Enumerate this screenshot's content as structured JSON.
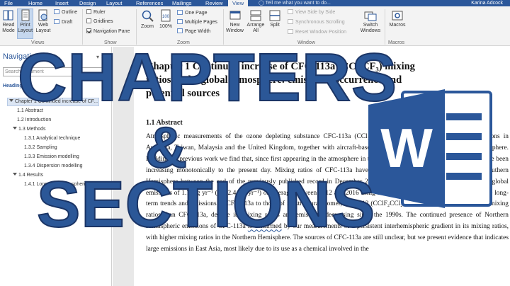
{
  "tabs": [
    "File",
    "Home",
    "Insert",
    "Design",
    "Layout",
    "References",
    "Mailings",
    "Review",
    "View"
  ],
  "active_tab": "View",
  "tell_me": "Tell me what you want to do...",
  "user_name": "Karina Adcock",
  "ribbon": {
    "views": {
      "read_mode_l1": "Read",
      "read_mode_l2": "Mode",
      "print_layout_l1": "Print",
      "print_layout_l2": "Layout",
      "web_layout_l1": "Web",
      "web_layout_l2": "Layout",
      "outline": "Outline",
      "draft": "Draft",
      "group": "Views"
    },
    "show": {
      "ruler": "Ruler",
      "gridlines": "Gridlines",
      "nav_pane": "Navigation Pane",
      "ruler_checked": false,
      "gridlines_checked": false,
      "nav_pane_checked": true,
      "group": "Show"
    },
    "zoom": {
      "zoom": "Zoom",
      "hundred": "100%",
      "one_page": "One Page",
      "multiple_pages": "Multiple Pages",
      "page_width": "Page Width",
      "group": "Zoom"
    },
    "window": {
      "new_window_l1": "New",
      "new_window_l2": "Window",
      "arrange_all_l1": "Arrange",
      "arrange_all_l2": "All",
      "split": "Split",
      "side_by_side": "View Side by Side",
      "sync_scroll": "Synchronous Scrolling",
      "reset_position": "Reset Window Position",
      "switch_l1": "Switch",
      "switch_l2": "Windows",
      "group": "Window"
    },
    "macros": {
      "label": "Macros",
      "group": "Macros"
    }
  },
  "navigation": {
    "title": "Navigation",
    "search_placeholder": "Search document",
    "tabs_label": "Headings",
    "items": [
      {
        "label": "Chapter 1 Continued increase of CF...",
        "level": 1,
        "selected": true,
        "expanded": true
      },
      {
        "label": "1.1 Abstract",
        "level": 2
      },
      {
        "label": "1.2 Introduction",
        "level": 2
      },
      {
        "label": "1.3 Methods",
        "level": 2,
        "expanded": true
      },
      {
        "label": "1.3.1 Analytical technique",
        "level": 3
      },
      {
        "label": "1.3.2 Sampling",
        "level": 3
      },
      {
        "label": "1.3.3 Emission modelling",
        "level": 3
      },
      {
        "label": "1.3.4 Dispersion modelling",
        "level": 3
      },
      {
        "label": "1.4 Results",
        "level": 2,
        "expanded": true
      },
      {
        "label": "1.4.1 Long-term atmospheric t...",
        "level": 3
      }
    ]
  },
  "document": {
    "title_line1": "Chapter 1 Continued increase of CFC-113a (CCl₃CF₃) mixing",
    "title_line2": "ratios in the global atmosphere: emissions, occurrence and",
    "title_line3": "potential sources",
    "heading": "1.1 Abstract",
    "paragraph": "Atmospheric measurements of the ozone depleting substance CFC-113a (CCl₃CF₃) are reported from ground-based stations in Australia, Taiwan, Malaysia and the United Kingdom, together with aircraft-based data for the upper troposphere and stratosphere. Building on previous work we find that, since first appearing in the atmosphere in the 1960s, global CFC-113a mixing ratios have been increasing monotonically to the present day. Mixing ratios of CFC-113a have increased by 40 % (percent) ... in the Southern Hemisphere between the end of the previously published record in December 2012 and February 2017. We derive updated global emissions of 1.7 Gg yr⁻¹ (1.5-2.4 Gg yr⁻¹) on average between 2012 and 2016 using a two-dimensional model. We compare the long-term trends and emissions of CFC-113a to those of its structural isomer, CFC-113 (CClF₂CCl₂F), which still has much higher mixing ratios than CFC-113a, despite its mixing ratios and emissions decreasing since the 1990s. The continued presence of Northern Hemispheric emissions of CFC-113a ",
    "paragraph_underlined": "is confirmed",
    "paragraph_rest": " by our measurements of a persistent interhemispheric gradient in its mixing ratios, with higher mixing ratios in the Northern Hemisphere. The sources of CFC-113a are still unclear, but we present evidence that indicates large emissions in East Asia, most likely due to its use as a chemical involved in the"
  },
  "overlay": {
    "line1": "CHAPTERS",
    "line2": "&",
    "line3": "SECTIONS",
    "logo_letter": "W"
  },
  "colors": {
    "word_blue": "#2b579a",
    "overlay_blue": "#2b5797",
    "ribbon_bg": "#f3f3f3"
  }
}
